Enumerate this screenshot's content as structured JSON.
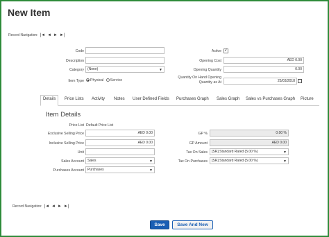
{
  "page": {
    "title": "New Item"
  },
  "record_nav": {
    "label": "Record Navigation:",
    "first": "|◄",
    "prev": "◄",
    "next": "►",
    "last": "►|"
  },
  "form": {
    "code": {
      "label": "Code",
      "value": ""
    },
    "description": {
      "label": "Description",
      "value": ""
    },
    "category": {
      "label": "Category",
      "value": "(None)"
    },
    "item_type": {
      "label": "Item Type",
      "options": [
        "Physical",
        "Service"
      ],
      "selected": "Physical"
    },
    "active": {
      "label": "Active",
      "checked": true
    },
    "opening_cost": {
      "label": "Opening Cost",
      "value": "AED 0.00"
    },
    "opening_quantity": {
      "label": "Opening Quantity",
      "value": "0.00"
    },
    "qty_on_hand_line1": "Quantity On Hand Opening",
    "qty_on_hand_line2": "Quantity as At",
    "qty_on_hand_date": "25/03/2018"
  },
  "tabs": [
    "Details",
    "Price Lists",
    "Activity",
    "Notes",
    "User Defined Fields",
    "Purchases Graph",
    "Sales Graph",
    "Sales vs Purchases Graph",
    "Picture"
  ],
  "details": {
    "section_title": "Item Details",
    "price_list": {
      "label": "Price List",
      "value": "Default Price List"
    },
    "exclusive_selling_price": {
      "label": "Exclusive Selling Price",
      "value": "AED 0.00"
    },
    "inclusive_selling_price": {
      "label": "Inclusive Selling Price",
      "value": "AED 0.00"
    },
    "unit": {
      "label": "Unit",
      "value": ""
    },
    "sales_account": {
      "label": "Sales Account",
      "value": "Sales"
    },
    "purchases_account": {
      "label": "Purchases Account",
      "value": "Purchases"
    },
    "gp_percent": {
      "label": "GP %",
      "value": "0.00 %"
    },
    "gp_amount": {
      "label": "GP Amount",
      "value": "AED 0.00"
    },
    "tax_on_sales": {
      "label": "Tax On Sales",
      "value": "[SR] Standard Rated (5.00 %)"
    },
    "tax_on_purchases": {
      "label": "Tax On Purchases",
      "value": "[SR] Standard Rated (5.00 %)"
    }
  },
  "buttons": {
    "save": "Save",
    "save_and_new": "Save And New"
  }
}
